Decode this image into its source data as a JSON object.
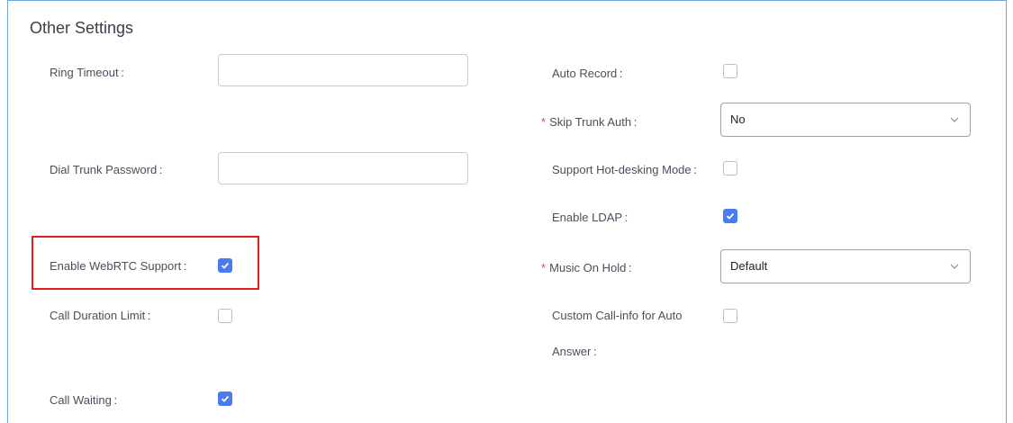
{
  "section": {
    "title": "Other Settings"
  },
  "left": {
    "ring_timeout": {
      "label": "Ring Timeout",
      "value": ""
    },
    "dial_trunk_password": {
      "label": "Dial Trunk Password",
      "value": ""
    },
    "enable_webrtc": {
      "label": "Enable WebRTC Support",
      "checked": true
    },
    "call_duration_limit": {
      "label": "Call Duration Limit",
      "checked": false
    },
    "call_waiting": {
      "label": "Call Waiting",
      "checked": true
    }
  },
  "right": {
    "auto_record": {
      "label": "Auto Record",
      "checked": false
    },
    "skip_trunk_auth": {
      "label": "Skip Trunk Auth",
      "value": "No",
      "required_mark": "*"
    },
    "hot_desking": {
      "label": "Support Hot-desking Mode",
      "checked": false
    },
    "enable_ldap": {
      "label": "Enable LDAP",
      "checked": true
    },
    "music_on_hold": {
      "label": "Music On Hold",
      "value": "Default",
      "required_mark": "*"
    },
    "custom_call_info": {
      "label_line1": "Custom Call-info for Auto",
      "label_line2": "Answer",
      "checked": false
    }
  },
  "colors": {
    "checkbox_checked": "#4a7bf0",
    "highlight_border": "#e01c1c",
    "required": "#e24b3b"
  },
  "label_suffix": ":"
}
